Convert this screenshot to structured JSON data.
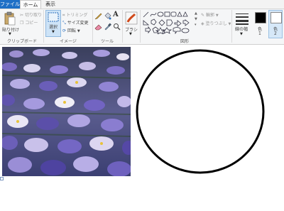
{
  "tabs": {
    "file": "ファイル",
    "home": "ホーム",
    "view": "表示"
  },
  "clipboard": {
    "paste": "貼り付け",
    "cut": "切り取り",
    "copy": "コピー",
    "group": "クリップボード"
  },
  "image": {
    "select": "選択",
    "crop": "トリミング",
    "resize": "サイズ変更",
    "rotate": "回転",
    "group": "イメージ"
  },
  "tools": {
    "group": "ツール"
  },
  "brushes": {
    "label": "ブラシ"
  },
  "shapes": {
    "group": "図形",
    "outline": "輪郭",
    "fill": "塗りつぶし"
  },
  "size": {
    "label": "線の幅"
  },
  "colors": {
    "color1": "色",
    "color1_num": "1",
    "color2": "色",
    "color2_num": "2",
    "color1_value": "#000000",
    "color2_value": "#ffffff"
  }
}
